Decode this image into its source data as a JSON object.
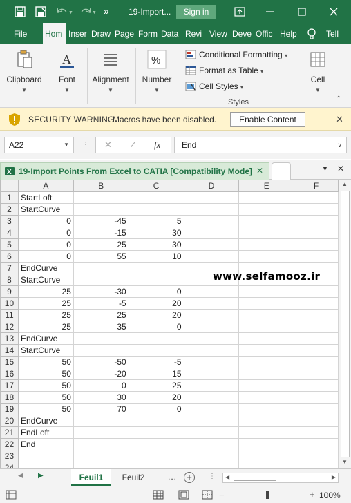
{
  "titlebar": {
    "title": "19-Import...",
    "sign_in": "Sign in",
    "more": "»"
  },
  "tabs": [
    "File",
    "Home",
    "Insert",
    "Draw",
    "Page Layout",
    "Formulas",
    "Data",
    "Review",
    "View",
    "Developer",
    "Office",
    "Help",
    "Tell me"
  ],
  "tab_display": [
    "File",
    "Hom",
    "Inser",
    "Draw",
    "Page",
    "Form",
    "Data",
    "Revi",
    "View",
    "Deve",
    "Offic",
    "Help",
    "Tell"
  ],
  "ribbon": {
    "clipboard": "Clipboard",
    "font": "Font",
    "alignment": "Alignment",
    "number": "Number",
    "conditional_formatting": "Conditional Formatting",
    "format_as_table": "Format as Table",
    "cell_styles": "Cell Styles",
    "styles_group": "Styles",
    "cells": "Cell"
  },
  "security": {
    "title": "SECURITY WARNING",
    "message": "Macros have been disabled.",
    "button": "Enable Content"
  },
  "formula_bar": {
    "name_box": "A22",
    "value": "End"
  },
  "workbook": {
    "tab_title": "19-Import Points From Excel to CATIA  [Compatibility Mode]"
  },
  "columns": [
    "A",
    "B",
    "C",
    "D",
    "E",
    "F"
  ],
  "rows": [
    {
      "n": "1",
      "a": "StartLoft",
      "b": "",
      "c": ""
    },
    {
      "n": "2",
      "a": "StartCurve",
      "b": "",
      "c": ""
    },
    {
      "n": "3",
      "a": "0",
      "b": "-45",
      "c": "5"
    },
    {
      "n": "4",
      "a": "0",
      "b": "-15",
      "c": "30"
    },
    {
      "n": "5",
      "a": "0",
      "b": "25",
      "c": "30"
    },
    {
      "n": "6",
      "a": "0",
      "b": "55",
      "c": "10"
    },
    {
      "n": "7",
      "a": "EndCurve",
      "b": "",
      "c": ""
    },
    {
      "n": "8",
      "a": "StartCurve",
      "b": "",
      "c": ""
    },
    {
      "n": "9",
      "a": "25",
      "b": "-30",
      "c": "0"
    },
    {
      "n": "10",
      "a": "25",
      "b": "-5",
      "c": "20"
    },
    {
      "n": "11",
      "a": "25",
      "b": "25",
      "c": "20"
    },
    {
      "n": "12",
      "a": "25",
      "b": "35",
      "c": "0"
    },
    {
      "n": "13",
      "a": "EndCurve",
      "b": "",
      "c": ""
    },
    {
      "n": "14",
      "a": "StartCurve",
      "b": "",
      "c": ""
    },
    {
      "n": "15",
      "a": "50",
      "b": "-50",
      "c": "-5"
    },
    {
      "n": "16",
      "a": "50",
      "b": "-20",
      "c": "15"
    },
    {
      "n": "17",
      "a": "50",
      "b": "0",
      "c": "25"
    },
    {
      "n": "18",
      "a": "50",
      "b": "30",
      "c": "20"
    },
    {
      "n": "19",
      "a": "50",
      "b": "70",
      "c": "0"
    },
    {
      "n": "20",
      "a": "EndCurve",
      "b": "",
      "c": ""
    },
    {
      "n": "21",
      "a": "EndLoft",
      "b": "",
      "c": ""
    },
    {
      "n": "22",
      "a": "End",
      "b": "",
      "c": ""
    },
    {
      "n": "23",
      "a": "",
      "b": "",
      "c": ""
    },
    {
      "n": "24",
      "a": "",
      "b": "",
      "c": ""
    }
  ],
  "watermark": "www.selfamooz.ir",
  "sheets": {
    "active": "Feuil1",
    "other": "Feuil2",
    "more": "..."
  },
  "status": {
    "zoom": "100%"
  },
  "colors": {
    "accent": "#217346",
    "warning_bg": "#fff4ce"
  }
}
